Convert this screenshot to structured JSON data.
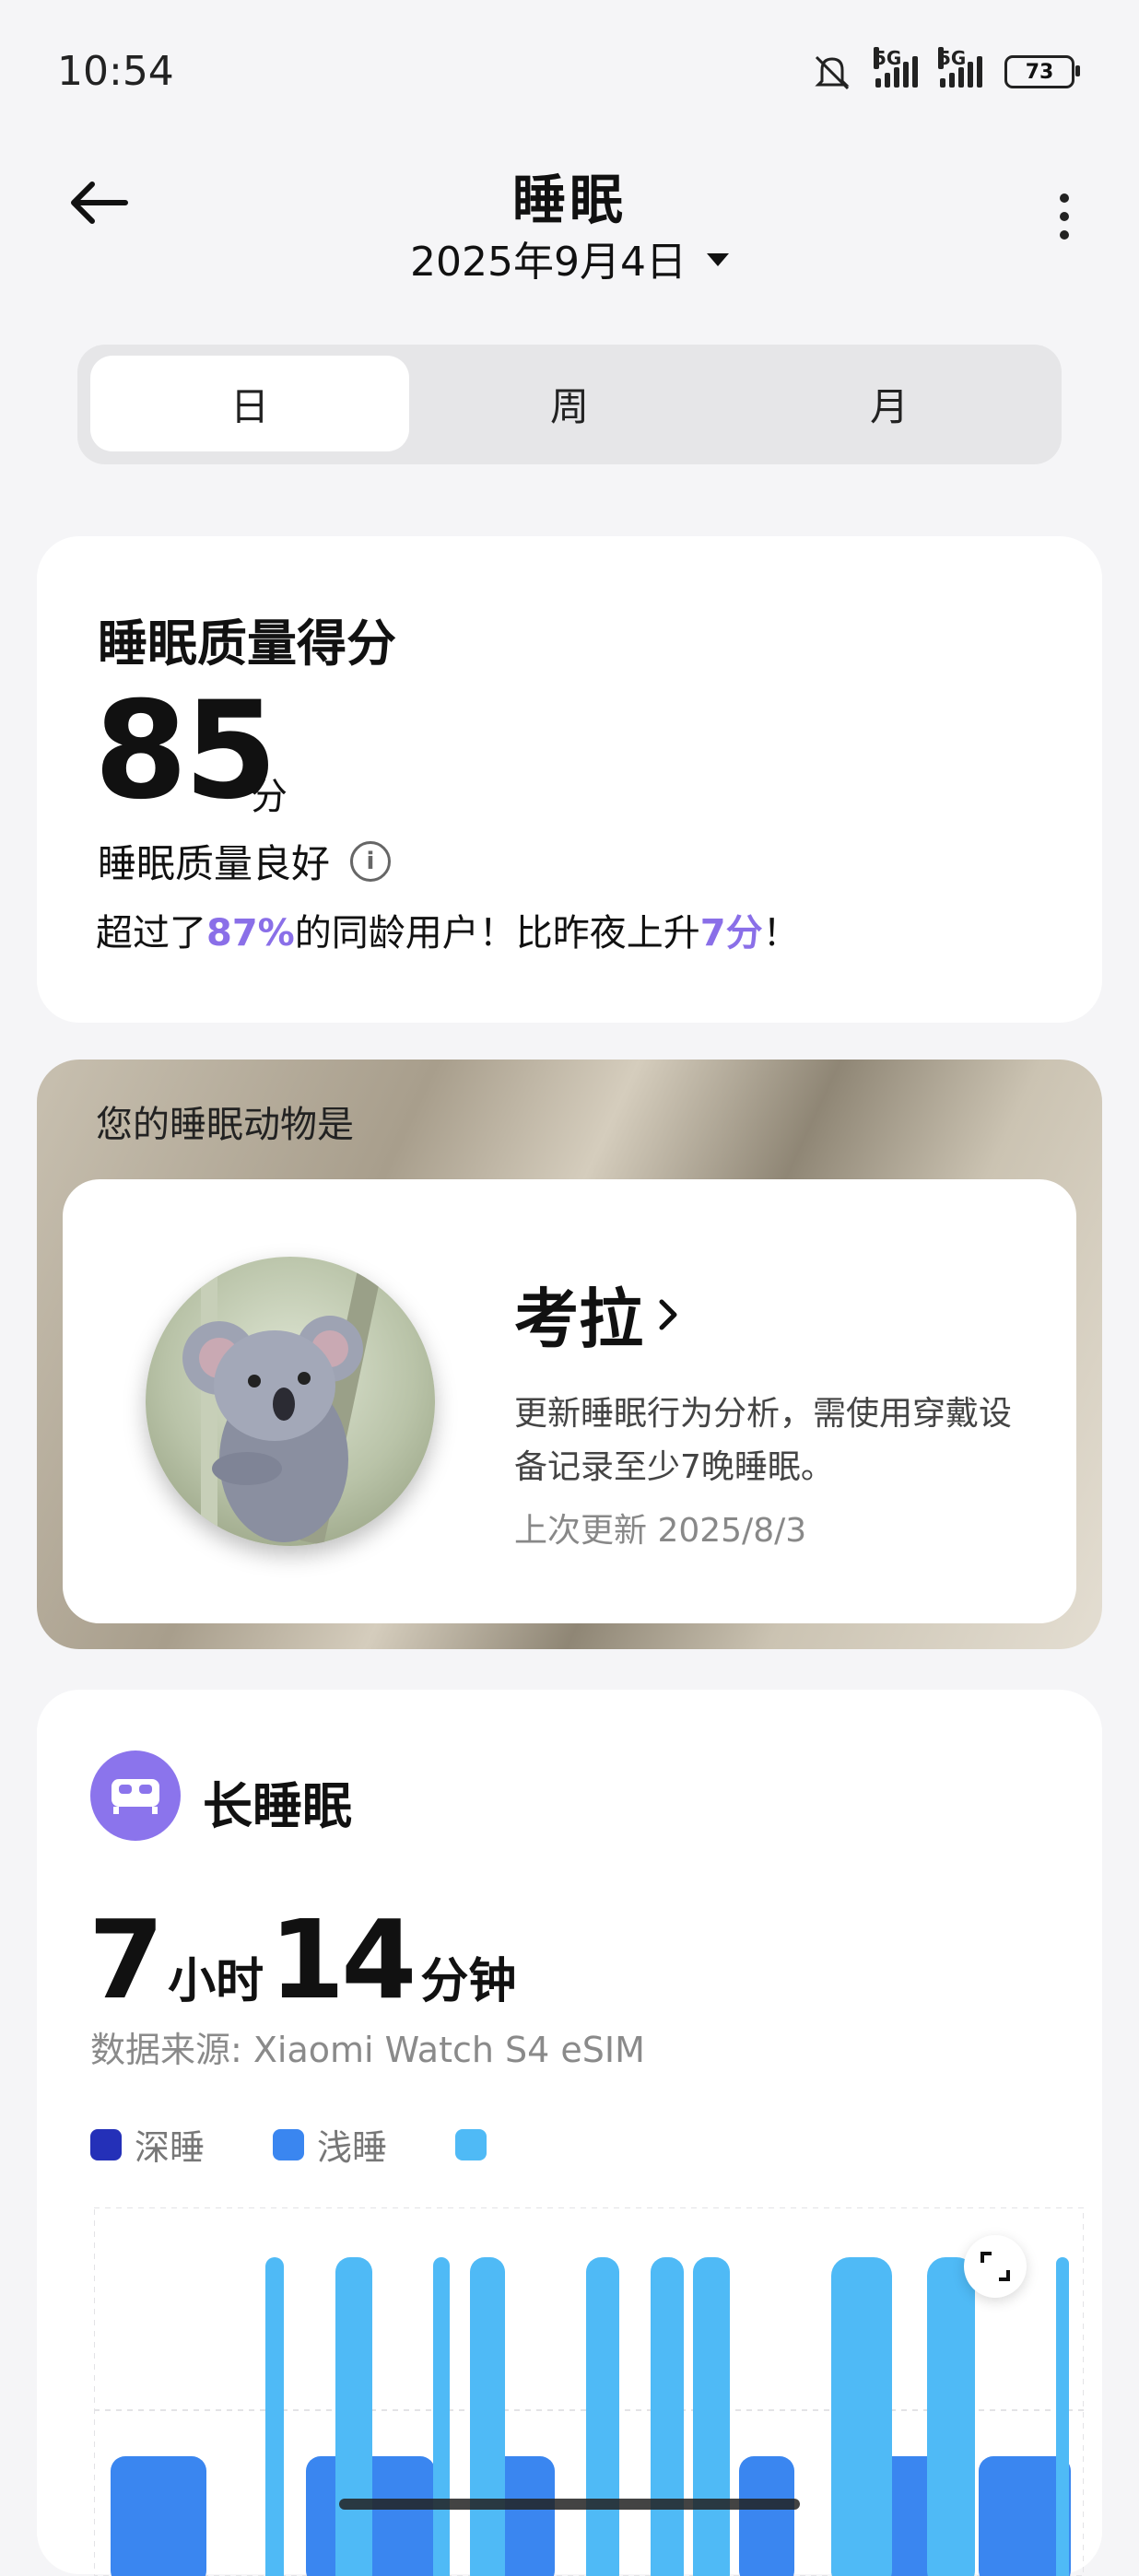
{
  "status_bar": {
    "time": "10:54",
    "network_1": "5G",
    "network_2": "5G",
    "battery": "73"
  },
  "header": {
    "title": "睡眠",
    "date": "2025年9月4日"
  },
  "tabs": [
    {
      "label": "日",
      "active": true
    },
    {
      "label": "周",
      "active": false
    },
    {
      "label": "月",
      "active": false
    }
  ],
  "score": {
    "label": "睡眠质量得分",
    "value": "85",
    "unit": "分",
    "status": "睡眠质量良好",
    "compare_prefix": "超过了",
    "percent": "87%",
    "compare_mid": "的同龄用户！比昨夜上升",
    "increase": "7分",
    "compare_suffix": "！"
  },
  "animal": {
    "heading": "您的睡眠动物是",
    "name": "考拉",
    "description": "更新睡眠行为分析，需使用穿戴设备记录至少7晚睡眠。",
    "updated": "上次更新 2025/8/3"
  },
  "sleep": {
    "title": "长睡眠",
    "hours": "7",
    "hours_unit": "小时",
    "minutes": "14",
    "minutes_unit": "分钟",
    "source": "数据来源: Xiaomi Watch S4 eSIM",
    "legend": [
      {
        "label": "深睡",
        "color": "#2430b8"
      },
      {
        "label": "浅睡",
        "color": "#3a86f0"
      },
      {
        "label": "",
        "color": "#4fbaf6"
      }
    ]
  },
  "colors": {
    "accent": "#8a6fe8",
    "deep": "#2430b8",
    "light": "#3a86f0",
    "rem": "#4fbaf6"
  },
  "icons": [
    "back-arrow-icon",
    "more-vertical-icon",
    "mute-bell-icon",
    "info-icon",
    "chevron-right-icon",
    "bed-icon",
    "expand-icon"
  ]
}
